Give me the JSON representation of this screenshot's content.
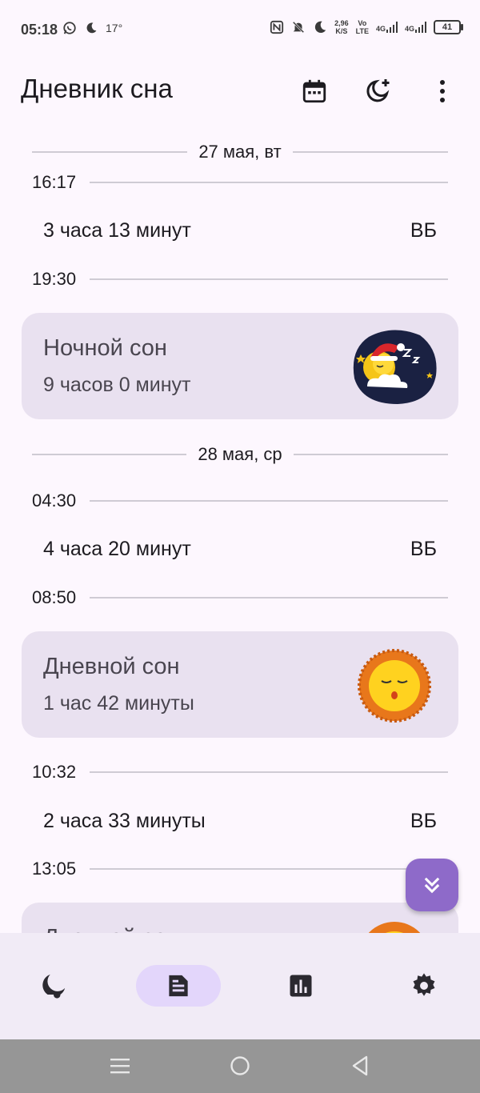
{
  "status_bar": {
    "time": "05:18",
    "temperature": "17°",
    "net_speed_value": "2,96",
    "net_speed_unit": "K/S",
    "volte_top": "Vo",
    "volte_bottom": "LTE",
    "sig1": "4G",
    "sig2": "4G",
    "battery": "41"
  },
  "app_bar": {
    "title": "Дневник сна",
    "icons": [
      "calendar-icon",
      "moon-plus-icon",
      "more-vert-icon"
    ]
  },
  "entries": {
    "date1": "27 мая, вт",
    "t1": "16:17",
    "awake1": {
      "duration": "3 часа 13 минут",
      "tag": "ВБ"
    },
    "t2": "19:30",
    "card1": {
      "title": "Ночной сон",
      "duration": "9 часов 0 минут",
      "image": "night-sleep-moon-santa-hat"
    },
    "date2": "28 мая, ср",
    "t3": "04:30",
    "awake2": {
      "duration": "4 часа 20 минут",
      "tag": "ВБ"
    },
    "t4": "08:50",
    "card2": {
      "title": "Дневной сон",
      "duration": "1 час 42 минуты",
      "image": "day-sleep-sun"
    },
    "t5": "10:32",
    "awake3": {
      "duration": "2 часа 33 минуты",
      "tag": "ВБ"
    },
    "t6": "13:05",
    "card3": {
      "title": "Дневной сон",
      "image": "day-sleep-sun"
    }
  },
  "fab": {
    "icon": "double-chevron-down-icon"
  },
  "bottom_nav": {
    "items": [
      "sleep-moon-icon",
      "journal-icon",
      "stats-icon",
      "settings-icon"
    ],
    "active": "journal-icon"
  },
  "colors": {
    "background": "#fdf7fe",
    "card": "#e9e1f0",
    "accent": "#8e6ac9",
    "nav_active": "#e3d6fb",
    "nav_bg": "#f1ebf6"
  }
}
